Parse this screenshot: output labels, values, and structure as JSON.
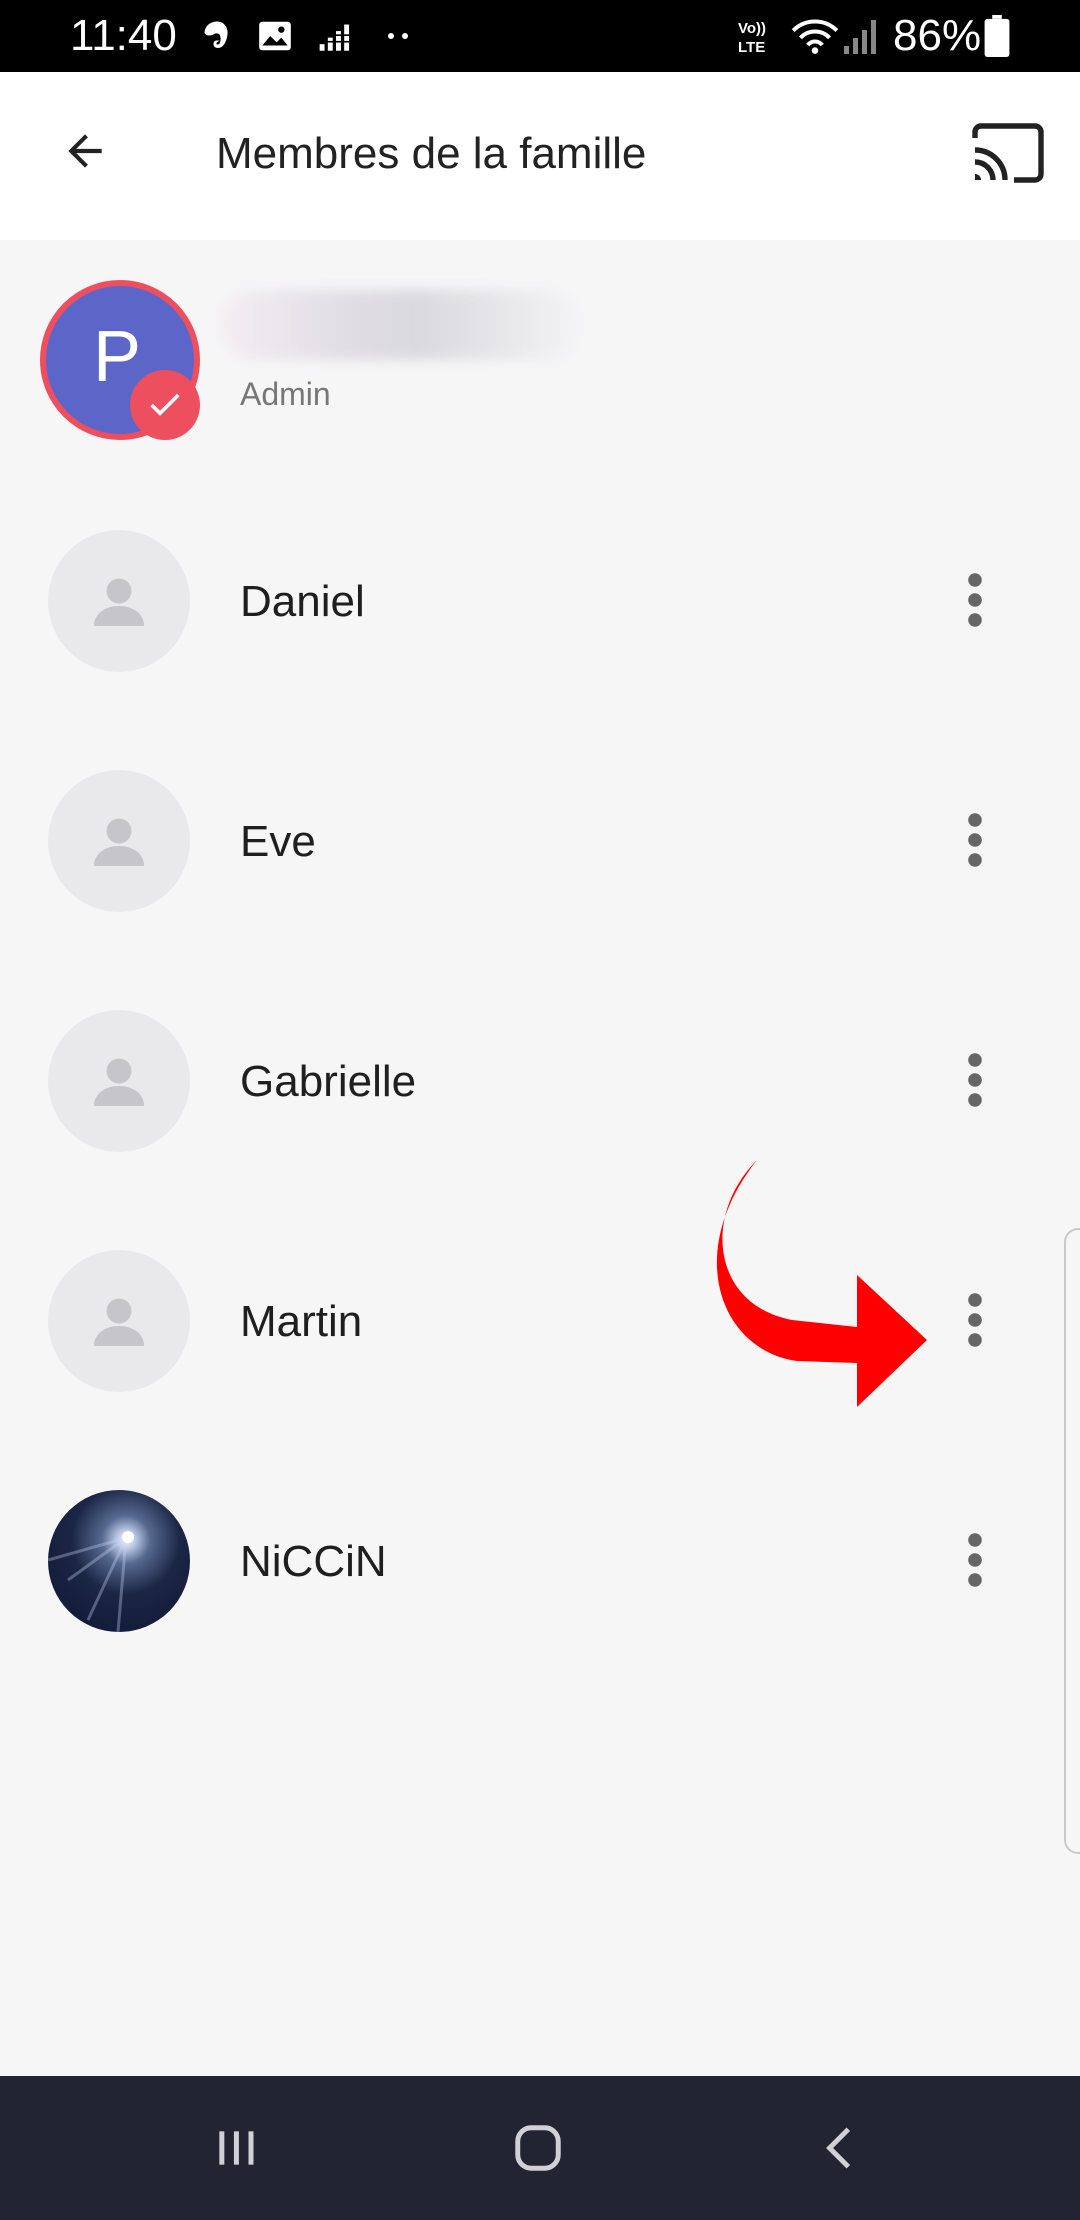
{
  "status_bar": {
    "time": "11:40",
    "battery": "86%",
    "icons": [
      "evernote-icon",
      "gallery-icon",
      "equalizer-icon",
      "more-dots-icon",
      "volte-icon",
      "wifi-icon",
      "signal-icon",
      "battery-icon"
    ]
  },
  "app_bar": {
    "title": "Membres de la famille",
    "back_icon": "arrow-back-icon",
    "cast_icon": "cast-icon"
  },
  "admin": {
    "initial": "P",
    "role": "Admin",
    "avatar_color": "#5b66c8",
    "badge_color": "#ee4f5f"
  },
  "members": [
    {
      "name": "Daniel",
      "avatar": "default-person-icon"
    },
    {
      "name": "Eve",
      "avatar": "default-person-icon"
    },
    {
      "name": "Gabrielle",
      "avatar": "default-person-icon"
    },
    {
      "name": "Martin",
      "avatar": "default-person-icon"
    },
    {
      "name": "NiCCiN",
      "avatar": "photo-avatar"
    }
  ],
  "annotation": {
    "arrow_color": "#ff0000",
    "points_to": "Martin more-options"
  },
  "nav_bar": {
    "recents_icon": "recents-icon",
    "home_icon": "home-icon",
    "back_icon": "nav-back-icon"
  }
}
